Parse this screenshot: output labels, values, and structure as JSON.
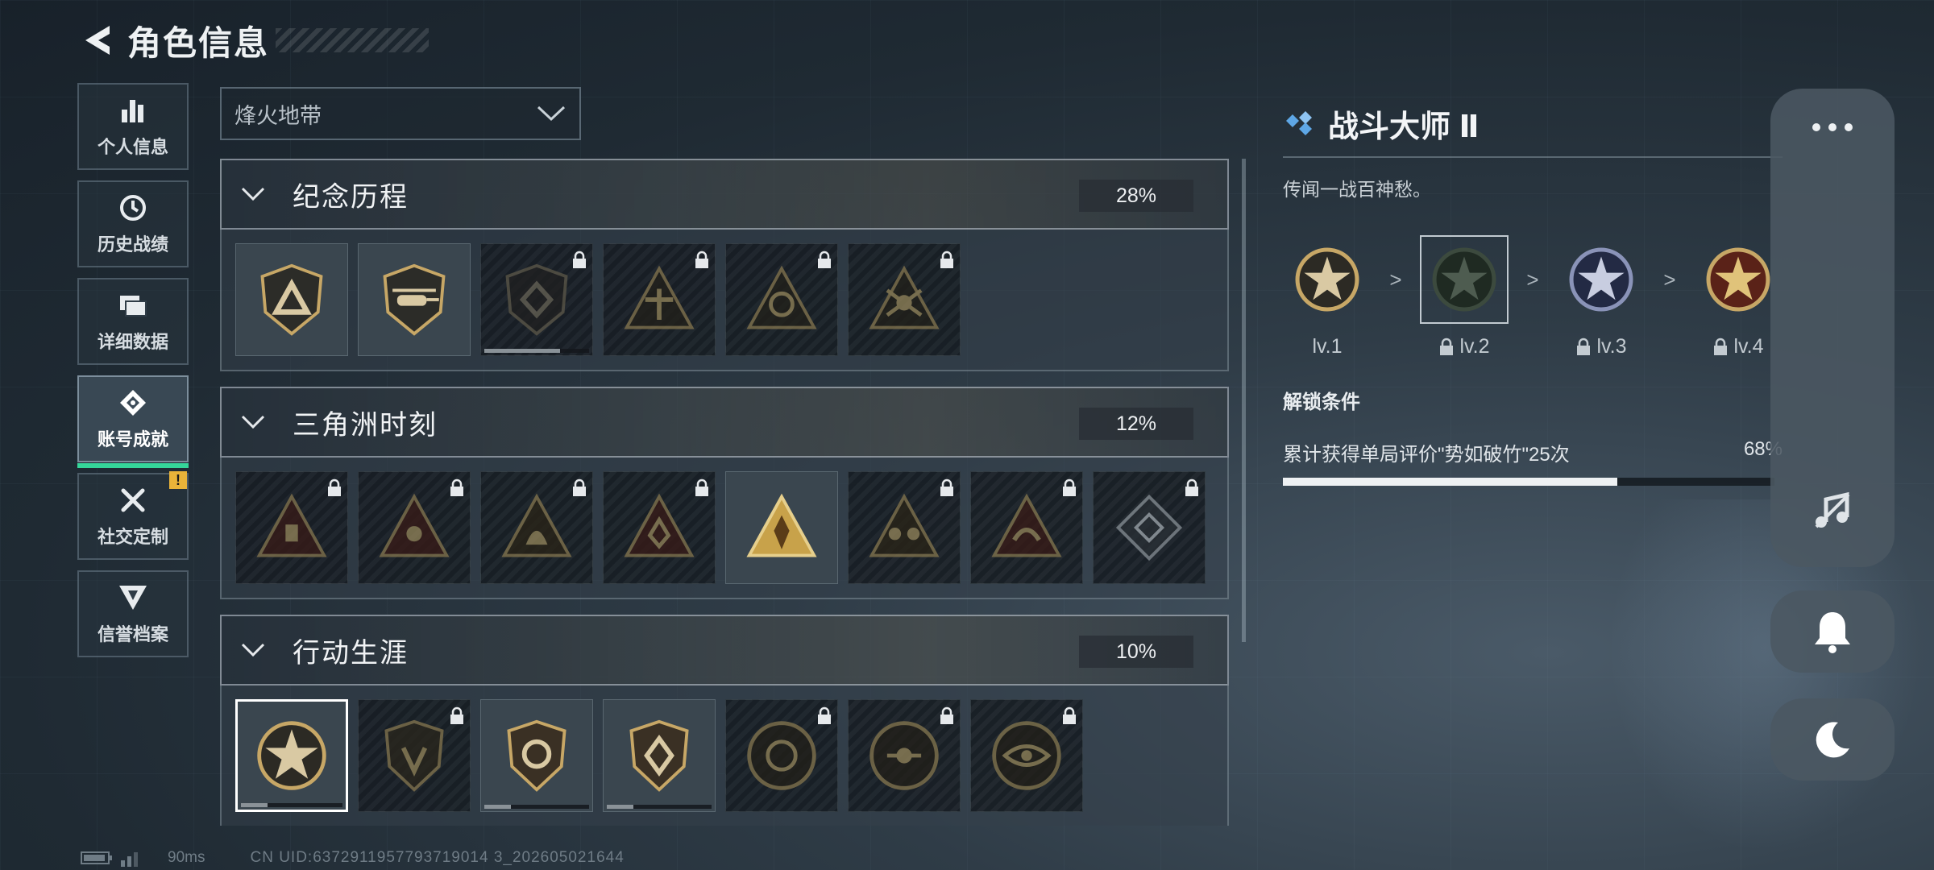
{
  "header": {
    "title": "角色信息"
  },
  "nav": {
    "items": [
      {
        "label": "个人信息"
      },
      {
        "label": "历史战绩"
      },
      {
        "label": "详细数据"
      },
      {
        "label": "账号成就"
      },
      {
        "label": "社交定制",
        "badge": "!"
      },
      {
        "label": "信誉档案"
      }
    ]
  },
  "mode": {
    "selected": "烽火地带"
  },
  "sections": [
    {
      "title": "纪念历程",
      "percent": "28%"
    },
    {
      "title": "三角洲时刻",
      "percent": "12%"
    },
    {
      "title": "行动生涯",
      "percent": "10%"
    }
  ],
  "detail": {
    "title": "战斗大师 Ⅱ",
    "description": "传闻一战百神愁。",
    "levels": [
      {
        "label": "lv.1"
      },
      {
        "label": "lv.2"
      },
      {
        "label": "lv.3"
      },
      {
        "label": "lv.4"
      }
    ],
    "separator": ">",
    "condition_title": "解锁条件",
    "condition_text": "累计获得单局评价\"势如破竹\"25次",
    "condition_percent": "68%",
    "condition_progress": 0.68
  },
  "footer": {
    "ping": "90ms",
    "uid": "CN UID:6372911957793719014 3_202605021644"
  },
  "colors": {
    "accent_green": "#35d69a",
    "warning": "#e9b339",
    "gold": "#c7a766"
  }
}
